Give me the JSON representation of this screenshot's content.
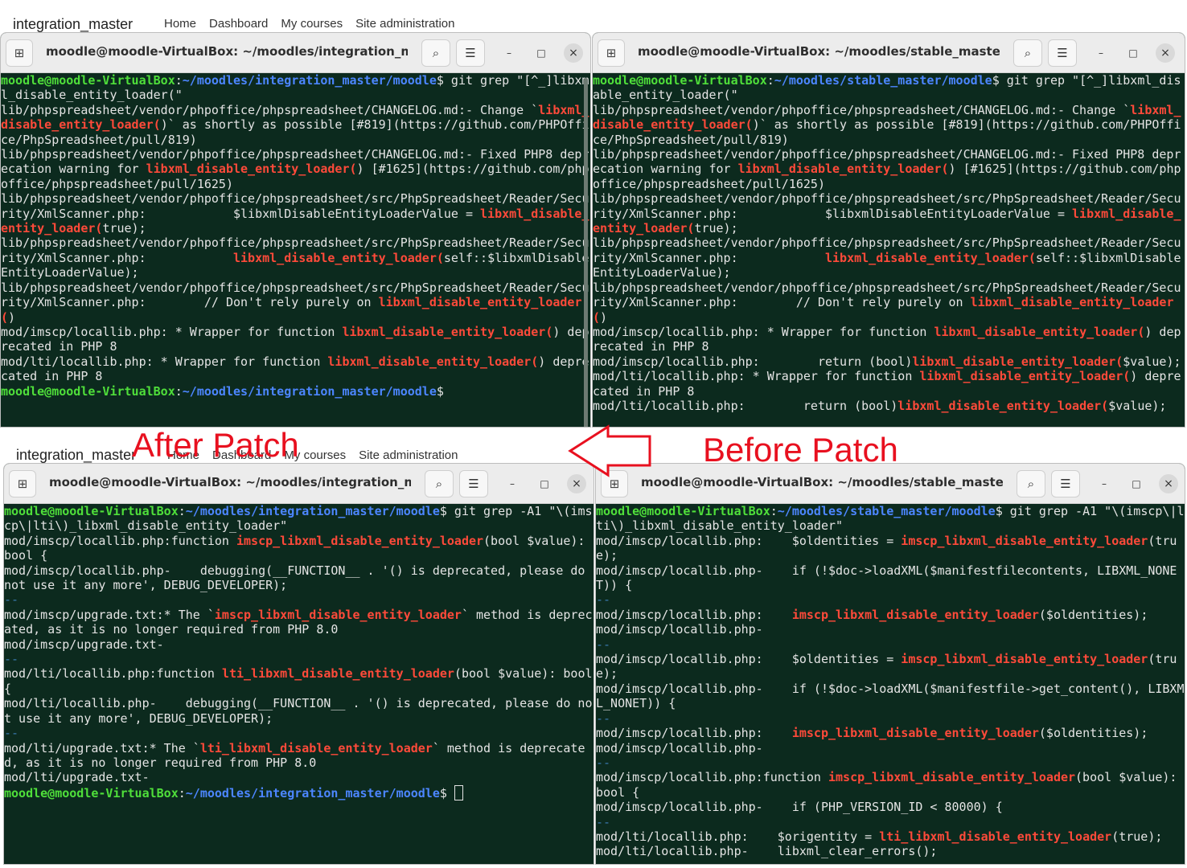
{
  "background_bar": {
    "brand": "integration_master",
    "nav": [
      "Home",
      "Dashboard",
      "My courses",
      "Site administration"
    ]
  },
  "annotations": {
    "after": "After Patch",
    "before": "Before Patch"
  },
  "colors": {
    "terminal_bg": "#0c2a1e",
    "prompt_user": "#4fdf3a",
    "prompt_path": "#4c86ff",
    "match_highlight": "#ff4a3a",
    "annotation": "#e8101f"
  },
  "icons": {
    "new_tab": "new-tab-icon",
    "search": "search-icon",
    "menu": "hamburger-menu-icon",
    "minimize": "minimize-icon",
    "maximize": "maximize-icon",
    "close": "close-icon"
  },
  "terminals": {
    "top_left": {
      "title": "moodle@moodle-VirtualBox: ~/moodles/integration_master...",
      "lines": [
        [
          [
            "p",
            "moodle@moodle-VirtualBox"
          ],
          [
            "t",
            ":"
          ],
          [
            "b",
            "~/moodles/integration_master/moodle"
          ],
          [
            "t",
            "$ git grep \"[^_]libxml_disable_entity_loader(\""
          ]
        ],
        [
          [
            "t",
            "lib/phpspreadsheet/vendor/phpoffice/phpspreadsheet/CHANGELOG.md:- Change `"
          ],
          [
            "r",
            "libxml_disable_entity_loader("
          ],
          [
            "t",
            ")` as shortly as possible [#819](https://github.com/PHPOffice/PhpSpreadsheet/pull/819)"
          ]
        ],
        [
          [
            "t",
            "lib/phpspreadsheet/vendor/phpoffice/phpspreadsheet/CHANGELOG.md:- Fixed PHP8 deprecation warning for "
          ],
          [
            "r",
            "libxml_disable_entity_loader("
          ],
          [
            "t",
            ") [#1625](https://github.com/phpoffice/phpspreadsheet/pull/1625)"
          ]
        ],
        [
          [
            "t",
            "lib/phpspreadsheet/vendor/phpoffice/phpspreadsheet/src/PhpSpreadsheet/Reader/Security/XmlScanner.php:            $libxmlDisableEntityLoaderValue = "
          ],
          [
            "r",
            "libxml_disable_entity_loader("
          ],
          [
            "t",
            "true);"
          ]
        ],
        [
          [
            "t",
            "lib/phpspreadsheet/vendor/phpoffice/phpspreadsheet/src/PhpSpreadsheet/Reader/Security/XmlScanner.php:            "
          ],
          [
            "r",
            "libxml_disable_entity_loader("
          ],
          [
            "t",
            "self::$libxmlDisableEntityLoaderValue);"
          ]
        ],
        [
          [
            "t",
            "lib/phpspreadsheet/vendor/phpoffice/phpspreadsheet/src/PhpSpreadsheet/Reader/Security/XmlScanner.php:        // Don't rely purely on "
          ],
          [
            "r",
            "libxml_disable_entity_loader("
          ],
          [
            "t",
            ")"
          ]
        ],
        [
          [
            "t",
            "mod/imscp/locallib.php: * Wrapper for function "
          ],
          [
            "r",
            "libxml_disable_entity_loader("
          ],
          [
            "t",
            ") deprecated in PHP 8"
          ]
        ],
        [
          [
            "t",
            "mod/lti/locallib.php: * Wrapper for function "
          ],
          [
            "r",
            "libxml_disable_entity_loader("
          ],
          [
            "t",
            ") deprecated in PHP 8"
          ]
        ],
        [
          [
            "p",
            "moodle@moodle-VirtualBox"
          ],
          [
            "t",
            ":"
          ],
          [
            "b",
            "~/moodles/integration_master/moodle"
          ],
          [
            "t",
            "$"
          ]
        ]
      ]
    },
    "top_right": {
      "title": "moodle@moodle-VirtualBox: ~/moodles/stable_master/moo...",
      "lines": [
        [
          [
            "p",
            "moodle@moodle-VirtualBox"
          ],
          [
            "t",
            ":"
          ],
          [
            "b",
            "~/moodles/stable_master/moodle"
          ],
          [
            "t",
            "$ git grep \"[^_]libxml_disable_entity_loader(\""
          ]
        ],
        [
          [
            "t",
            "lib/phpspreadsheet/vendor/phpoffice/phpspreadsheet/CHANGELOG.md:- Change `"
          ],
          [
            "r",
            "libxml_disable_entity_loader("
          ],
          [
            "t",
            ")` as shortly as possible [#819](https://github.com/PHPOffice/PhpSpreadsheet/pull/819)"
          ]
        ],
        [
          [
            "t",
            "lib/phpspreadsheet/vendor/phpoffice/phpspreadsheet/CHANGELOG.md:- Fixed PHP8 deprecation warning for "
          ],
          [
            "r",
            "libxml_disable_entity_loader("
          ],
          [
            "t",
            ") [#1625](https://github.com/phpoffice/phpspreadsheet/pull/1625)"
          ]
        ],
        [
          [
            "t",
            "lib/phpspreadsheet/vendor/phpoffice/phpspreadsheet/src/PhpSpreadsheet/Reader/Security/XmlScanner.php:            $libxmlDisableEntityLoaderValue = "
          ],
          [
            "r",
            "libxml_disable_entity_loader("
          ],
          [
            "t",
            "true);"
          ]
        ],
        [
          [
            "t",
            "lib/phpspreadsheet/vendor/phpoffice/phpspreadsheet/src/PhpSpreadsheet/Reader/Security/XmlScanner.php:            "
          ],
          [
            "r",
            "libxml_disable_entity_loader("
          ],
          [
            "t",
            "self::$libxmlDisableEntityLoaderValue);"
          ]
        ],
        [
          [
            "t",
            "lib/phpspreadsheet/vendor/phpoffice/phpspreadsheet/src/PhpSpreadsheet/Reader/Security/XmlScanner.php:        // Don't rely purely on "
          ],
          [
            "r",
            "libxml_disable_entity_loader("
          ],
          [
            "t",
            ")"
          ]
        ],
        [
          [
            "t",
            "mod/imscp/locallib.php: * Wrapper for function "
          ],
          [
            "r",
            "libxml_disable_entity_loader("
          ],
          [
            "t",
            ") deprecated in PHP 8"
          ]
        ],
        [
          [
            "t",
            "mod/imscp/locallib.php:        return (bool)"
          ],
          [
            "r",
            "libxml_disable_entity_loader("
          ],
          [
            "t",
            "$value);"
          ]
        ],
        [
          [
            "t",
            "mod/lti/locallib.php: * Wrapper for function "
          ],
          [
            "r",
            "libxml_disable_entity_loader("
          ],
          [
            "t",
            ") deprecated in PHP 8"
          ]
        ],
        [
          [
            "t",
            "mod/lti/locallib.php:        return (bool)"
          ],
          [
            "r",
            "libxml_disable_entity_loader("
          ],
          [
            "t",
            "$value);"
          ]
        ]
      ]
    },
    "bottom_left": {
      "title": "moodle@moodle-VirtualBox: ~/moodles/integration_master...",
      "lines": [
        [
          [
            "p",
            "moodle@moodle-VirtualBox"
          ],
          [
            "t",
            ":"
          ],
          [
            "b",
            "~/moodles/integration_master/moodle"
          ],
          [
            "t",
            "$ git grep -A1 \"\\(imscp\\|lti\\)_libxml_disable_entity_loader\""
          ]
        ],
        [
          [
            "t",
            "mod/imscp/locallib.php:function "
          ],
          [
            "r",
            "imscp_libxml_disable_entity_loader"
          ],
          [
            "t",
            "(bool $value): bool {"
          ]
        ],
        [
          [
            "t",
            "mod/imscp/locallib.php-    debugging(__FUNCTION__ . '() is deprecated, please do not use it any more', DEBUG_DEVELOPER);"
          ]
        ],
        [
          [
            "s",
            "--"
          ]
        ],
        [
          [
            "t",
            "mod/imscp/upgrade.txt:* The `"
          ],
          [
            "r",
            "imscp_libxml_disable_entity_loader"
          ],
          [
            "t",
            "` method is deprecated, as it is no longer required from PHP 8.0"
          ]
        ],
        [
          [
            "t",
            "mod/imscp/upgrade.txt-"
          ]
        ],
        [
          [
            "s",
            "--"
          ]
        ],
        [
          [
            "t",
            "mod/lti/locallib.php:function "
          ],
          [
            "r",
            "lti_libxml_disable_entity_loader"
          ],
          [
            "t",
            "(bool $value): bool {"
          ]
        ],
        [
          [
            "t",
            "mod/lti/locallib.php-    debugging(__FUNCTION__ . '() is deprecated, please do not use it any more', DEBUG_DEVELOPER);"
          ]
        ],
        [
          [
            "s",
            "--"
          ]
        ],
        [
          [
            "t",
            "mod/lti/upgrade.txt:* The `"
          ],
          [
            "r",
            "lti_libxml_disable_entity_loader"
          ],
          [
            "t",
            "` method is deprecated, as it is no longer required from PHP 8.0"
          ]
        ],
        [
          [
            "t",
            "mod/lti/upgrade.txt-"
          ]
        ],
        [
          [
            "p",
            "moodle@moodle-VirtualBox"
          ],
          [
            "t",
            ":"
          ],
          [
            "b",
            "~/moodles/integration_master/moodle"
          ],
          [
            "t",
            "$ "
          ],
          [
            "c",
            ""
          ]
        ]
      ]
    },
    "bottom_right": {
      "title": "moodle@moodle-VirtualBox: ~/moodles/stable_master/moo...",
      "lines": [
        [
          [
            "p",
            "moodle@moodle-VirtualBox"
          ],
          [
            "t",
            ":"
          ],
          [
            "b",
            "~/moodles/stable_master/moodle"
          ],
          [
            "t",
            "$ git grep -A1 \"\\(imscp\\|lti\\)_libxml_disable_entity_loader\""
          ]
        ],
        [
          [
            "t",
            "mod/imscp/locallib.php:    $oldentities = "
          ],
          [
            "r",
            "imscp_libxml_disable_entity_loader"
          ],
          [
            "t",
            "(true);"
          ]
        ],
        [
          [
            "t",
            "mod/imscp/locallib.php-    if (!$doc->loadXML($manifestfilecontents, LIBXML_NONET)) {"
          ]
        ],
        [
          [
            "s",
            "--"
          ]
        ],
        [
          [
            "t",
            "mod/imscp/locallib.php:    "
          ],
          [
            "r",
            "imscp_libxml_disable_entity_loader"
          ],
          [
            "t",
            "($oldentities);"
          ]
        ],
        [
          [
            "t",
            "mod/imscp/locallib.php-"
          ]
        ],
        [
          [
            "s",
            "--"
          ]
        ],
        [
          [
            "t",
            "mod/imscp/locallib.php:    $oldentities = "
          ],
          [
            "r",
            "imscp_libxml_disable_entity_loader"
          ],
          [
            "t",
            "(true);"
          ]
        ],
        [
          [
            "t",
            "mod/imscp/locallib.php-    if (!$doc->loadXML($manifestfile->get_content(), LIBXML_NONET)) {"
          ]
        ],
        [
          [
            "s",
            "--"
          ]
        ],
        [
          [
            "t",
            "mod/imscp/locallib.php:    "
          ],
          [
            "r",
            "imscp_libxml_disable_entity_loader"
          ],
          [
            "t",
            "($oldentities);"
          ]
        ],
        [
          [
            "t",
            "mod/imscp/locallib.php-"
          ]
        ],
        [
          [
            "s",
            "--"
          ]
        ],
        [
          [
            "t",
            "mod/imscp/locallib.php:function "
          ],
          [
            "r",
            "imscp_libxml_disable_entity_loader"
          ],
          [
            "t",
            "(bool $value): bool {"
          ]
        ],
        [
          [
            "t",
            "mod/imscp/locallib.php-    if (PHP_VERSION_ID < 80000) {"
          ]
        ],
        [
          [
            "s",
            "--"
          ]
        ],
        [
          [
            "t",
            "mod/lti/locallib.php:    $origentity = "
          ],
          [
            "r",
            "lti_libxml_disable_entity_loader"
          ],
          [
            "t",
            "(true);"
          ]
        ],
        [
          [
            "t",
            "mod/lti/locallib.php-    libxml_clear_errors();"
          ]
        ]
      ]
    }
  }
}
